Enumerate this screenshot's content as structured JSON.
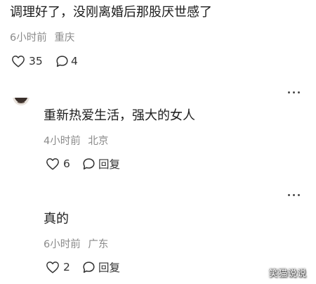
{
  "post": {
    "text": "调理好了，没刚离婚后那股厌世感了",
    "time": "6小时前",
    "location": "重庆",
    "likes": "35",
    "comments": "4"
  },
  "replies": [
    {
      "text": "重新热爱生活，强大的女人",
      "time": "4小时前",
      "location": "北京",
      "likes": "6",
      "reply_label": "回复"
    },
    {
      "text": "真的",
      "time": "6小时前",
      "location": "广东",
      "likes": "2",
      "reply_label": "回复"
    }
  ],
  "watermark": "笑猫说说",
  "icons": {
    "like": "heart-icon",
    "comment": "comment-bubble-icon",
    "more": "more-dots-icon"
  }
}
